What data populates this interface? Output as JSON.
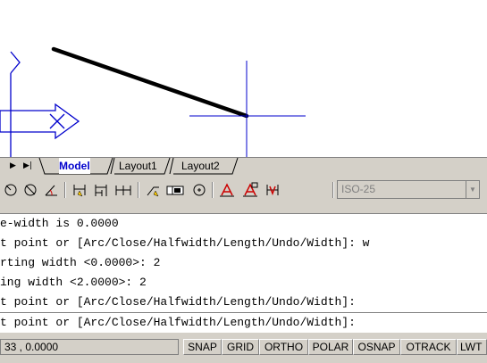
{
  "tabs": {
    "nav_prev": "▶",
    "nav_last": "▶|",
    "items": [
      {
        "label": "Model",
        "active": true
      },
      {
        "label": "Layout1",
        "active": false
      },
      {
        "label": "Layout2",
        "active": false
      }
    ]
  },
  "toolbar": {
    "icons": [
      "dim-radius-icon",
      "dim-diameter-icon",
      "dim-angular-icon",
      "quick-dim-icon",
      "dim-baseline-icon",
      "dim-continue-icon",
      "quick-leader-icon",
      "tolerance-icon",
      "center-mark-icon",
      "dim-edit-icon",
      "dim-text-edit-icon",
      "dim-update-icon"
    ],
    "dim_style_value": "ISO-25"
  },
  "command_history": [
    "e-width is 0.0000",
    "t point or [Arc/Close/Halfwidth/Length/Undo/Width]: w",
    "rting width <0.0000>: 2",
    "ing width <2.0000>: 2",
    "t point or [Arc/Close/Halfwidth/Length/Undo/Width]:"
  ],
  "command_prompt": "t point or [Arc/Close/Halfwidth/Length/Undo/Width]:",
  "status": {
    "coordinates": "33 , 0.0000",
    "buttons": [
      "SNAP",
      "GRID",
      "ORTHO",
      "POLAR",
      "OSNAP",
      "OTRACK",
      "LWT"
    ]
  },
  "colors": {
    "crosshair": "#0000cc",
    "polyline": "#000000",
    "ucs_icon": "#0000cc",
    "active_tab_text": "#0000cc",
    "chrome": "#d4d0c8"
  }
}
